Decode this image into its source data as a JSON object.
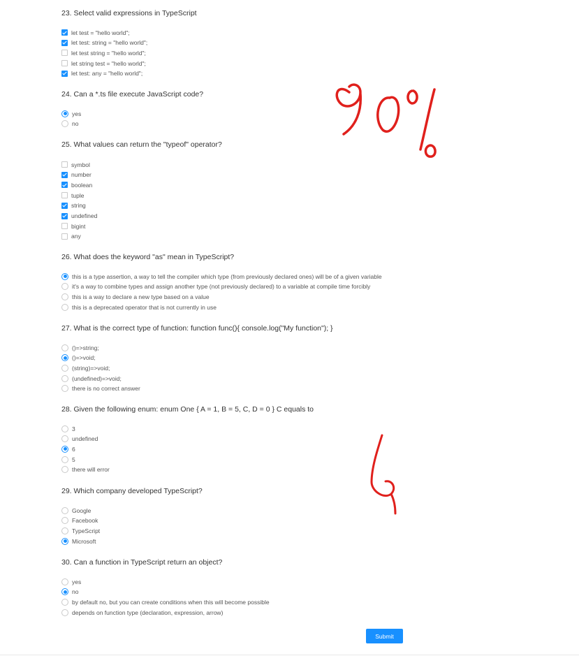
{
  "accent_color": "#1890ff",
  "annotation_color": "#e0201c",
  "questions": [
    {
      "title": "23. Select valid expressions in TypeScript",
      "type": "checkbox",
      "options": [
        {
          "label": "let test = \"hello world\";",
          "checked": true
        },
        {
          "label": "let test: string = \"hello world\";",
          "checked": true
        },
        {
          "label": "let test string = \"hello world\";",
          "checked": false
        },
        {
          "label": "let string test = \"hello world\";",
          "checked": false
        },
        {
          "label": "let test: any = \"hello world\";",
          "checked": true
        }
      ]
    },
    {
      "title": "24. Can a *.ts file execute JavaScript code?",
      "type": "radio",
      "options": [
        {
          "label": "yes",
          "checked": true
        },
        {
          "label": "no",
          "checked": false
        }
      ]
    },
    {
      "title": "25. What values can return the \"typeof\" operator?",
      "type": "checkbox",
      "options": [
        {
          "label": "symbol",
          "checked": false
        },
        {
          "label": "number",
          "checked": true
        },
        {
          "label": "boolean",
          "checked": true
        },
        {
          "label": "tuple",
          "checked": false
        },
        {
          "label": "string",
          "checked": true
        },
        {
          "label": "undefined",
          "checked": true
        },
        {
          "label": "bigint",
          "checked": false
        },
        {
          "label": "any",
          "checked": false
        }
      ]
    },
    {
      "title": "26. What does the keyword \"as\" mean in TypeScript?",
      "type": "radio",
      "options": [
        {
          "label": "this is a type assertion, a way to tell the compiler which type (from previously declared ones) will be of a given variable",
          "checked": true
        },
        {
          "label": "it's a way to combine types and assign another type (not previously declared) to a variable at compile time forcibly",
          "checked": false
        },
        {
          "label": "this is a way to declare a new type based on a value",
          "checked": false
        },
        {
          "label": "this is a deprecated operator that is not currently in use",
          "checked": false
        }
      ]
    },
    {
      "title": "27. What is the correct type of function: function func(){ console.log(\"My function\"); }",
      "type": "radio",
      "options": [
        {
          "label": "()=>string;",
          "checked": false
        },
        {
          "label": "()=>void;",
          "checked": true
        },
        {
          "label": "(string)=>void;",
          "checked": false
        },
        {
          "label": "(undefined)=>void;",
          "checked": false
        },
        {
          "label": "there is no correct answer",
          "checked": false
        }
      ]
    },
    {
      "title": "28. Given the following enum: enum One { A = 1, B = 5, C, D = 0 } C equals to",
      "type": "radio",
      "options": [
        {
          "label": "3",
          "checked": false
        },
        {
          "label": "undefined",
          "checked": false
        },
        {
          "label": "6",
          "checked": true
        },
        {
          "label": "5",
          "checked": false
        },
        {
          "label": "there will error",
          "checked": false
        }
      ]
    },
    {
      "title": "29. Which company developed TypeScript?",
      "type": "radio",
      "options": [
        {
          "label": "Google",
          "checked": false
        },
        {
          "label": "Facebook",
          "checked": false
        },
        {
          "label": "TypeScript",
          "checked": false
        },
        {
          "label": "Microsoft",
          "checked": true
        }
      ]
    },
    {
      "title": "30. Can a function in TypeScript return an object?",
      "type": "radio",
      "options": [
        {
          "label": "yes",
          "checked": false
        },
        {
          "label": "no",
          "checked": true
        },
        {
          "label": "by default no, but you can create conditions when this will become possible",
          "checked": false
        },
        {
          "label": "depends on function type (declaration, expression, arrow)",
          "checked": false
        }
      ]
    }
  ],
  "submit_label": "Submit",
  "handwritten_annotations": [
    {
      "name": "score-annotation",
      "text": "90%"
    },
    {
      "name": "answer-annotation",
      "text": "6"
    }
  ]
}
